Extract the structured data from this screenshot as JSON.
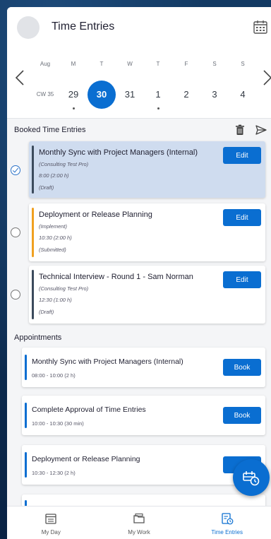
{
  "header": {
    "title": "Time Entries"
  },
  "week": {
    "month": "Aug",
    "cw": "CW 35",
    "day_letters": [
      "M",
      "T",
      "W",
      "T",
      "F",
      "S",
      "S"
    ],
    "dates": [
      "29",
      "30",
      "31",
      "1",
      "2",
      "3",
      "4"
    ],
    "selected_index": 1,
    "dots": [
      true,
      false,
      false,
      true,
      false,
      false,
      false
    ]
  },
  "booked": {
    "title": "Booked Time Entries",
    "entries": [
      {
        "title": "Monthly Sync with Project Managers (Internal)",
        "line1": "(Consulting Test Pro)",
        "line2": "8:00 (2:00 h)",
        "line3": "(Draft)",
        "button": "Edit",
        "color": "#3b4a5c",
        "selected": true
      },
      {
        "title": "Deployment or Release Planning",
        "line1": "(Implement)",
        "line2": "10:30 (2:00 h)",
        "line3": "(Submitted)",
        "button": "Edit",
        "color": "#f0a020",
        "selected": false
      },
      {
        "title": "Technical Interview - Round 1 - Sam Norman",
        "line1": "(Consulting Test Pro)",
        "line2": "12:30 (1:00 h)",
        "line3": "(Draft)",
        "button": "Edit",
        "color": "#3b4a5c",
        "selected": false
      }
    ]
  },
  "appointments": {
    "title": "Appointments",
    "items": [
      {
        "title": "Monthly Sync with Project Managers (Internal)",
        "time": "08:00 - 10:00 (2 h)",
        "button": "Book"
      },
      {
        "title": "Complete Approval of Time Entries",
        "time": "10:00 - 10:30 (30 min)",
        "button": "Book"
      },
      {
        "title": "Deployment or Release Planning",
        "time": "10:30 - 12:30 (2 h)",
        "button": ""
      }
    ]
  },
  "bottom_nav": [
    {
      "label": "My Day",
      "icon": "calendar-day-icon",
      "active": false
    },
    {
      "label": "My Work",
      "icon": "folder-icon",
      "active": false
    },
    {
      "label": "Time Entries",
      "icon": "time-entry-icon",
      "active": true
    }
  ],
  "colors": {
    "accent": "#0a6ed1",
    "selected_row": "#cfdcef",
    "submitted": "#f0a020",
    "draft": "#3b4a5c"
  }
}
